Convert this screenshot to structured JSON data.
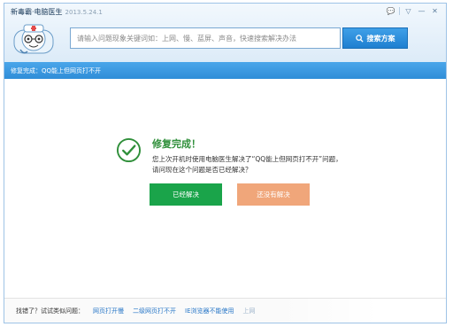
{
  "app": {
    "title": "新毒霸·电脑医生",
    "version": "2013.5.24.1"
  },
  "window_controls": {
    "chat_icon": "💬",
    "menu_icon": "▽",
    "minimize_icon": "—",
    "close_icon": "✕"
  },
  "search": {
    "placeholder": "请输入问题现象关键词如：上网、慢、蓝屏、声音，快速搜索解决办法",
    "button_label": "搜索方案"
  },
  "status": {
    "text": "修复完成：QQ能上但网页打不开"
  },
  "result": {
    "title": "修复完成！",
    "line1": "您上次开机时使用电脑医生解决了“QQ能上但网页打不开”问题，",
    "line2": "请问现在这个问题是否已经解决？",
    "solved_label": "已经解决",
    "unsolved_label": "还没有解决"
  },
  "footer": {
    "prompt": "找错了？试试类似问题：",
    "links": [
      "网页打开慢",
      "二级网页打不开",
      "IE浏览器不能使用",
      "上网"
    ]
  },
  "colors": {
    "accent_blue": "#2f8dd8",
    "success_green": "#1aa44a",
    "secondary_orange": "#f0a67a",
    "title_green": "#2f8f3a"
  }
}
